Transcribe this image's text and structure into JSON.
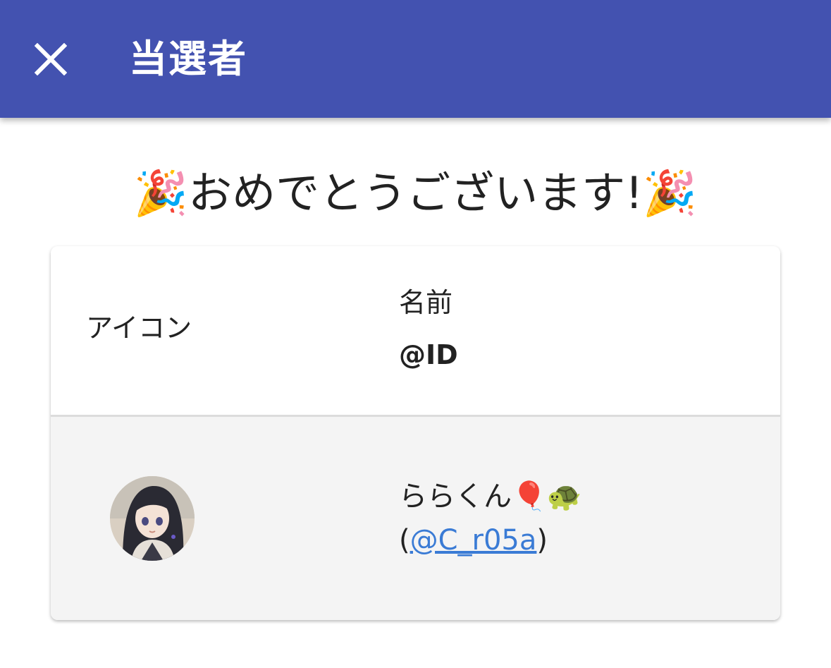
{
  "app_bar": {
    "title": "当選者",
    "close_icon": "close-icon",
    "background": "#4352b0"
  },
  "heading": {
    "emoji_left": "🎉",
    "text": "おめでとうございます!",
    "emoji_right": "🎉"
  },
  "table": {
    "columns": {
      "icon": "アイコン",
      "name": "名前",
      "id": "@ID"
    },
    "rows": [
      {
        "avatar": "winner-avatar",
        "name": "ららくん🎈🐢",
        "id_open": "(",
        "id_link": "@C_r05a",
        "id_close": ")"
      }
    ]
  },
  "colors": {
    "accent": "#4352b0",
    "link": "#3a7bd5",
    "row_background": "#f4f4f4"
  }
}
